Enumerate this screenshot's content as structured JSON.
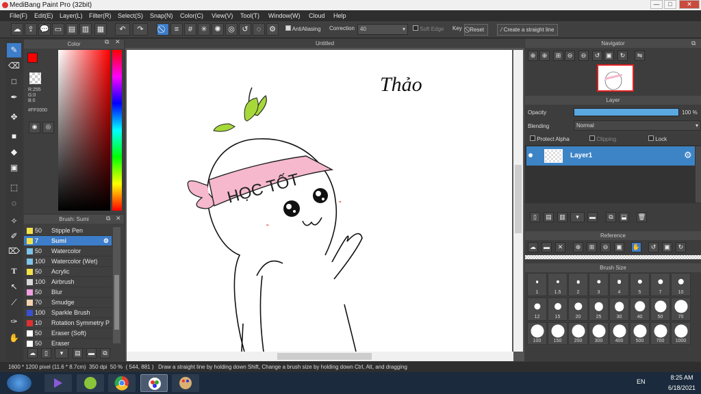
{
  "window": {
    "title": "MediBang Paint Pro (32bit)"
  },
  "menu": [
    "File(F)",
    "Edit(E)",
    "Layer(L)",
    "Filter(R)",
    "Select(S)",
    "Snap(N)",
    "Color(C)",
    "View(V)",
    "Tool(T)",
    "Window(W)",
    "Cloud",
    "Help"
  ],
  "toolbar": {
    "antialiasing": "AntiAliasing",
    "correction_label": "Correction",
    "correction_value": "40",
    "soft_edge": "Soft Edge",
    "key_label": "Key",
    "reset": "Reset",
    "straight_line": "Create a straight line"
  },
  "color_panel": {
    "title": "Color",
    "r": "R:255",
    "g": "G:0",
    "b": "B:0",
    "hex": "#FF0000",
    "current_color": "#ff0000"
  },
  "brush_panel": {
    "title": "Brush: Sumi",
    "brushes": [
      {
        "size": "50",
        "name": "Stipple Pen",
        "color": "#f2e24a"
      },
      {
        "size": "7",
        "name": "Sumi",
        "color": "#f2e24a",
        "selected": true
      },
      {
        "size": "50",
        "name": "Watercolor",
        "color": "#7ec3e8"
      },
      {
        "size": "100",
        "name": "Watercolor (Wet)",
        "color": "#7ec3e8"
      },
      {
        "size": "50",
        "name": "Acrylic",
        "color": "#f2e24a"
      },
      {
        "size": "100",
        "name": "Airbrush",
        "color": "#d8d8d8"
      },
      {
        "size": "50",
        "name": "Blur",
        "color": "#f0a0e0"
      },
      {
        "size": "70",
        "name": "Smudge",
        "color": "#f4d4b0"
      },
      {
        "size": "100",
        "name": "Sparkle Brush",
        "color": "#3a50d0"
      },
      {
        "size": "10",
        "name": "Rotation Symmetry P",
        "color": "#e03030"
      },
      {
        "size": "50",
        "name": "Eraser (Soft)",
        "color": "#ffffff"
      },
      {
        "size": "50",
        "name": "Eraser",
        "color": "#ffffff"
      }
    ]
  },
  "document": {
    "tab": "Untitled"
  },
  "drawing": {
    "signature": "Thảo",
    "headband": "HỌC TỐT"
  },
  "navigator": {
    "title": "Navigator"
  },
  "layer_panel": {
    "title": "Layer",
    "opacity_label": "Opacity",
    "opacity_value": "100 %",
    "opacity_fraction": 1.0,
    "blending_label": "Blending",
    "blending_value": "Normal",
    "protect_alpha": "Protect Alpha",
    "clipping": "Clipping",
    "lock": "Lock",
    "layers": [
      {
        "name": "Layer1"
      }
    ]
  },
  "reference": {
    "title": "Reference"
  },
  "brush_size": {
    "title": "Brush Size",
    "sizes": [
      "1",
      "1.5",
      "2",
      "3",
      "4",
      "5",
      "7",
      "10",
      "12",
      "15",
      "20",
      "25",
      "30",
      "40",
      "50",
      "70",
      "100",
      "150",
      "200",
      "300",
      "400",
      "500",
      "700",
      "1000"
    ]
  },
  "status": {
    "size": "1600 * 1200 pixel",
    "cm": "(11.6 * 8.7cm)",
    "dpi": "350 dpi",
    "zoom": "50 %",
    "coords": "( 544, 881 )",
    "hint": "Draw a straight line by holding down Shift, Change a brush size by holding down Ctrl, Alt, and dragging"
  },
  "taskbar": {
    "lang": "EN",
    "time": "8:25 AM",
    "date": "6/18/2021"
  }
}
